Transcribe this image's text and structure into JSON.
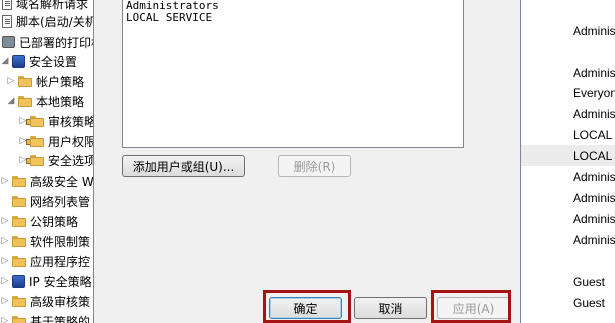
{
  "tree": {
    "items": [
      {
        "label": "域名解析请求",
        "icon": "doc-icon"
      },
      {
        "label": "脚本(启动/关机)",
        "icon": "doc-icon"
      },
      {
        "label": "已部署的打印机",
        "icon": "printer-icon"
      },
      {
        "label": "安全设置",
        "icon": "shield-icon"
      },
      {
        "label": "帐户策略",
        "icon": "folder-icon"
      },
      {
        "label": "本地策略",
        "icon": "folder-icon"
      },
      {
        "label": "审核策略",
        "icon": "folder-icon"
      },
      {
        "label": "用户权限",
        "icon": "folder-icon"
      },
      {
        "label": "安全选项",
        "icon": "folder-icon"
      },
      {
        "label": "高级安全 W",
        "icon": "folder-icon"
      },
      {
        "label": "网络列表管",
        "icon": "folder-icon"
      },
      {
        "label": "公钥策略",
        "icon": "folder-icon"
      },
      {
        "label": "软件限制策",
        "icon": "folder-icon"
      },
      {
        "label": "应用程序控",
        "icon": "folder-icon"
      },
      {
        "label": "IP 安全策略",
        "icon": "shield-icon"
      },
      {
        "label": "高级审核策",
        "icon": "folder-icon"
      },
      {
        "label": "基于策略的 Q",
        "icon": "folder-icon"
      }
    ]
  },
  "dialog": {
    "members": [
      "Administrators",
      "LOCAL SERVICE"
    ],
    "add_button": "添加用户或组(U)...",
    "remove_button": "删除(R)",
    "ok_button": "确定",
    "cancel_button": "取消",
    "apply_button": "应用(A)"
  },
  "right_pane": {
    "rows": [
      "Adminis",
      "Adminis",
      "Everyon",
      "Adminis",
      "LOCAL",
      "LOCAL",
      "Adminis",
      "Adminis",
      "Adminis",
      "Adminis",
      "Guest",
      "Guest"
    ]
  }
}
